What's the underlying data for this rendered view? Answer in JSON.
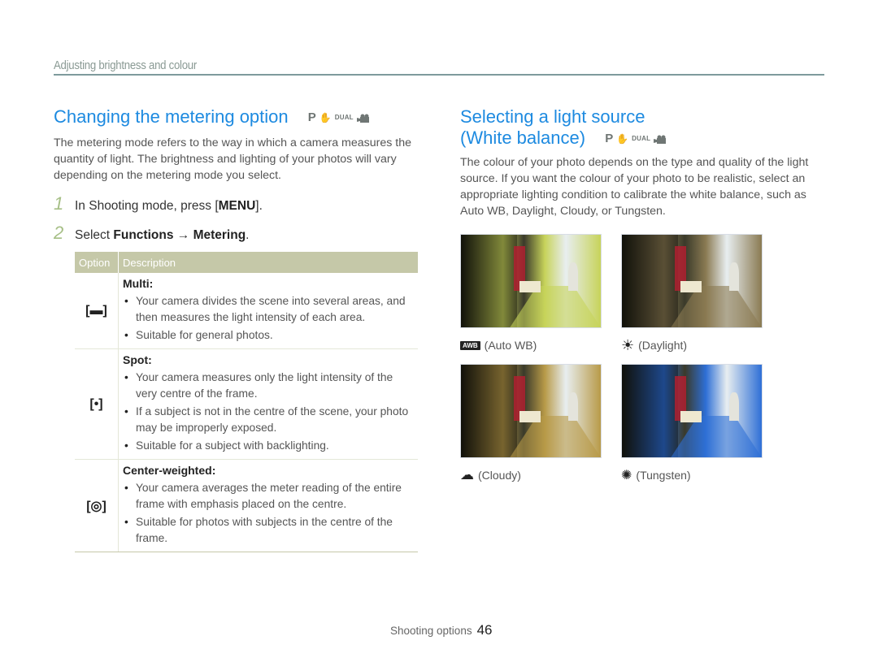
{
  "section_header": "Adjusting brightness and colour",
  "left": {
    "title": "Changing the metering option",
    "modes": {
      "p": "P",
      "dual": "DUAL"
    },
    "intro": "The metering mode refers to the way in which a camera measures the quantity of light. The brightness and lighting of your photos will vary depending on the metering mode you select.",
    "steps": [
      {
        "num": "1",
        "prefix": "In Shooting mode, press [",
        "bold": "MENU",
        "suffix": "]."
      },
      {
        "num": "2",
        "prefix": "Select ",
        "bold": "Functions",
        "arrow": " → ",
        "bold2": "Metering",
        "suffix": "."
      }
    ],
    "table": {
      "headers": {
        "option": "Option",
        "description": "Description"
      },
      "rows": [
        {
          "icon": "[▬]",
          "name": "Multi",
          "bullets": [
            "Your camera divides the scene into several areas, and then measures the light intensity of each area.",
            "Suitable for general photos."
          ]
        },
        {
          "icon": "[•]",
          "name": "Spot",
          "bullets": [
            "Your camera measures only the light intensity of the very centre of the frame.",
            "If a subject is not in the centre of the scene, your photo may be improperly exposed.",
            "Suitable for a subject with backlighting."
          ]
        },
        {
          "icon": "[◎]",
          "name": "Center-weighted",
          "bullets": [
            "Your camera averages the meter reading of the entire frame with emphasis placed on the centre.",
            "Suitable for photos with subjects in the centre of the frame."
          ]
        }
      ]
    }
  },
  "right": {
    "title_line1": "Selecting a light source",
    "title_line2": "(White balance)",
    "modes": {
      "p": "P",
      "dual": "DUAL"
    },
    "intro": "The colour of your photo depends on the type and quality of the light source. If you want the colour of your photo to be realistic, select an appropriate lighting condition to calibrate the white balance, such as Auto WB, Daylight, Cloudy, or Tungsten.",
    "photos": [
      {
        "icon": "AWB",
        "label": "(Auto WB)",
        "tint": "#c7d35a"
      },
      {
        "icon": "sun",
        "label": "(Daylight)",
        "tint": "#8a7a52"
      },
      {
        "icon": "cloud",
        "label": "(Cloudy)",
        "tint": "#b89a48"
      },
      {
        "icon": "tungsten",
        "label": "(Tungsten)",
        "tint": "#2e6fd6"
      }
    ]
  },
  "footer": {
    "label": "Shooting options",
    "page": "46"
  }
}
